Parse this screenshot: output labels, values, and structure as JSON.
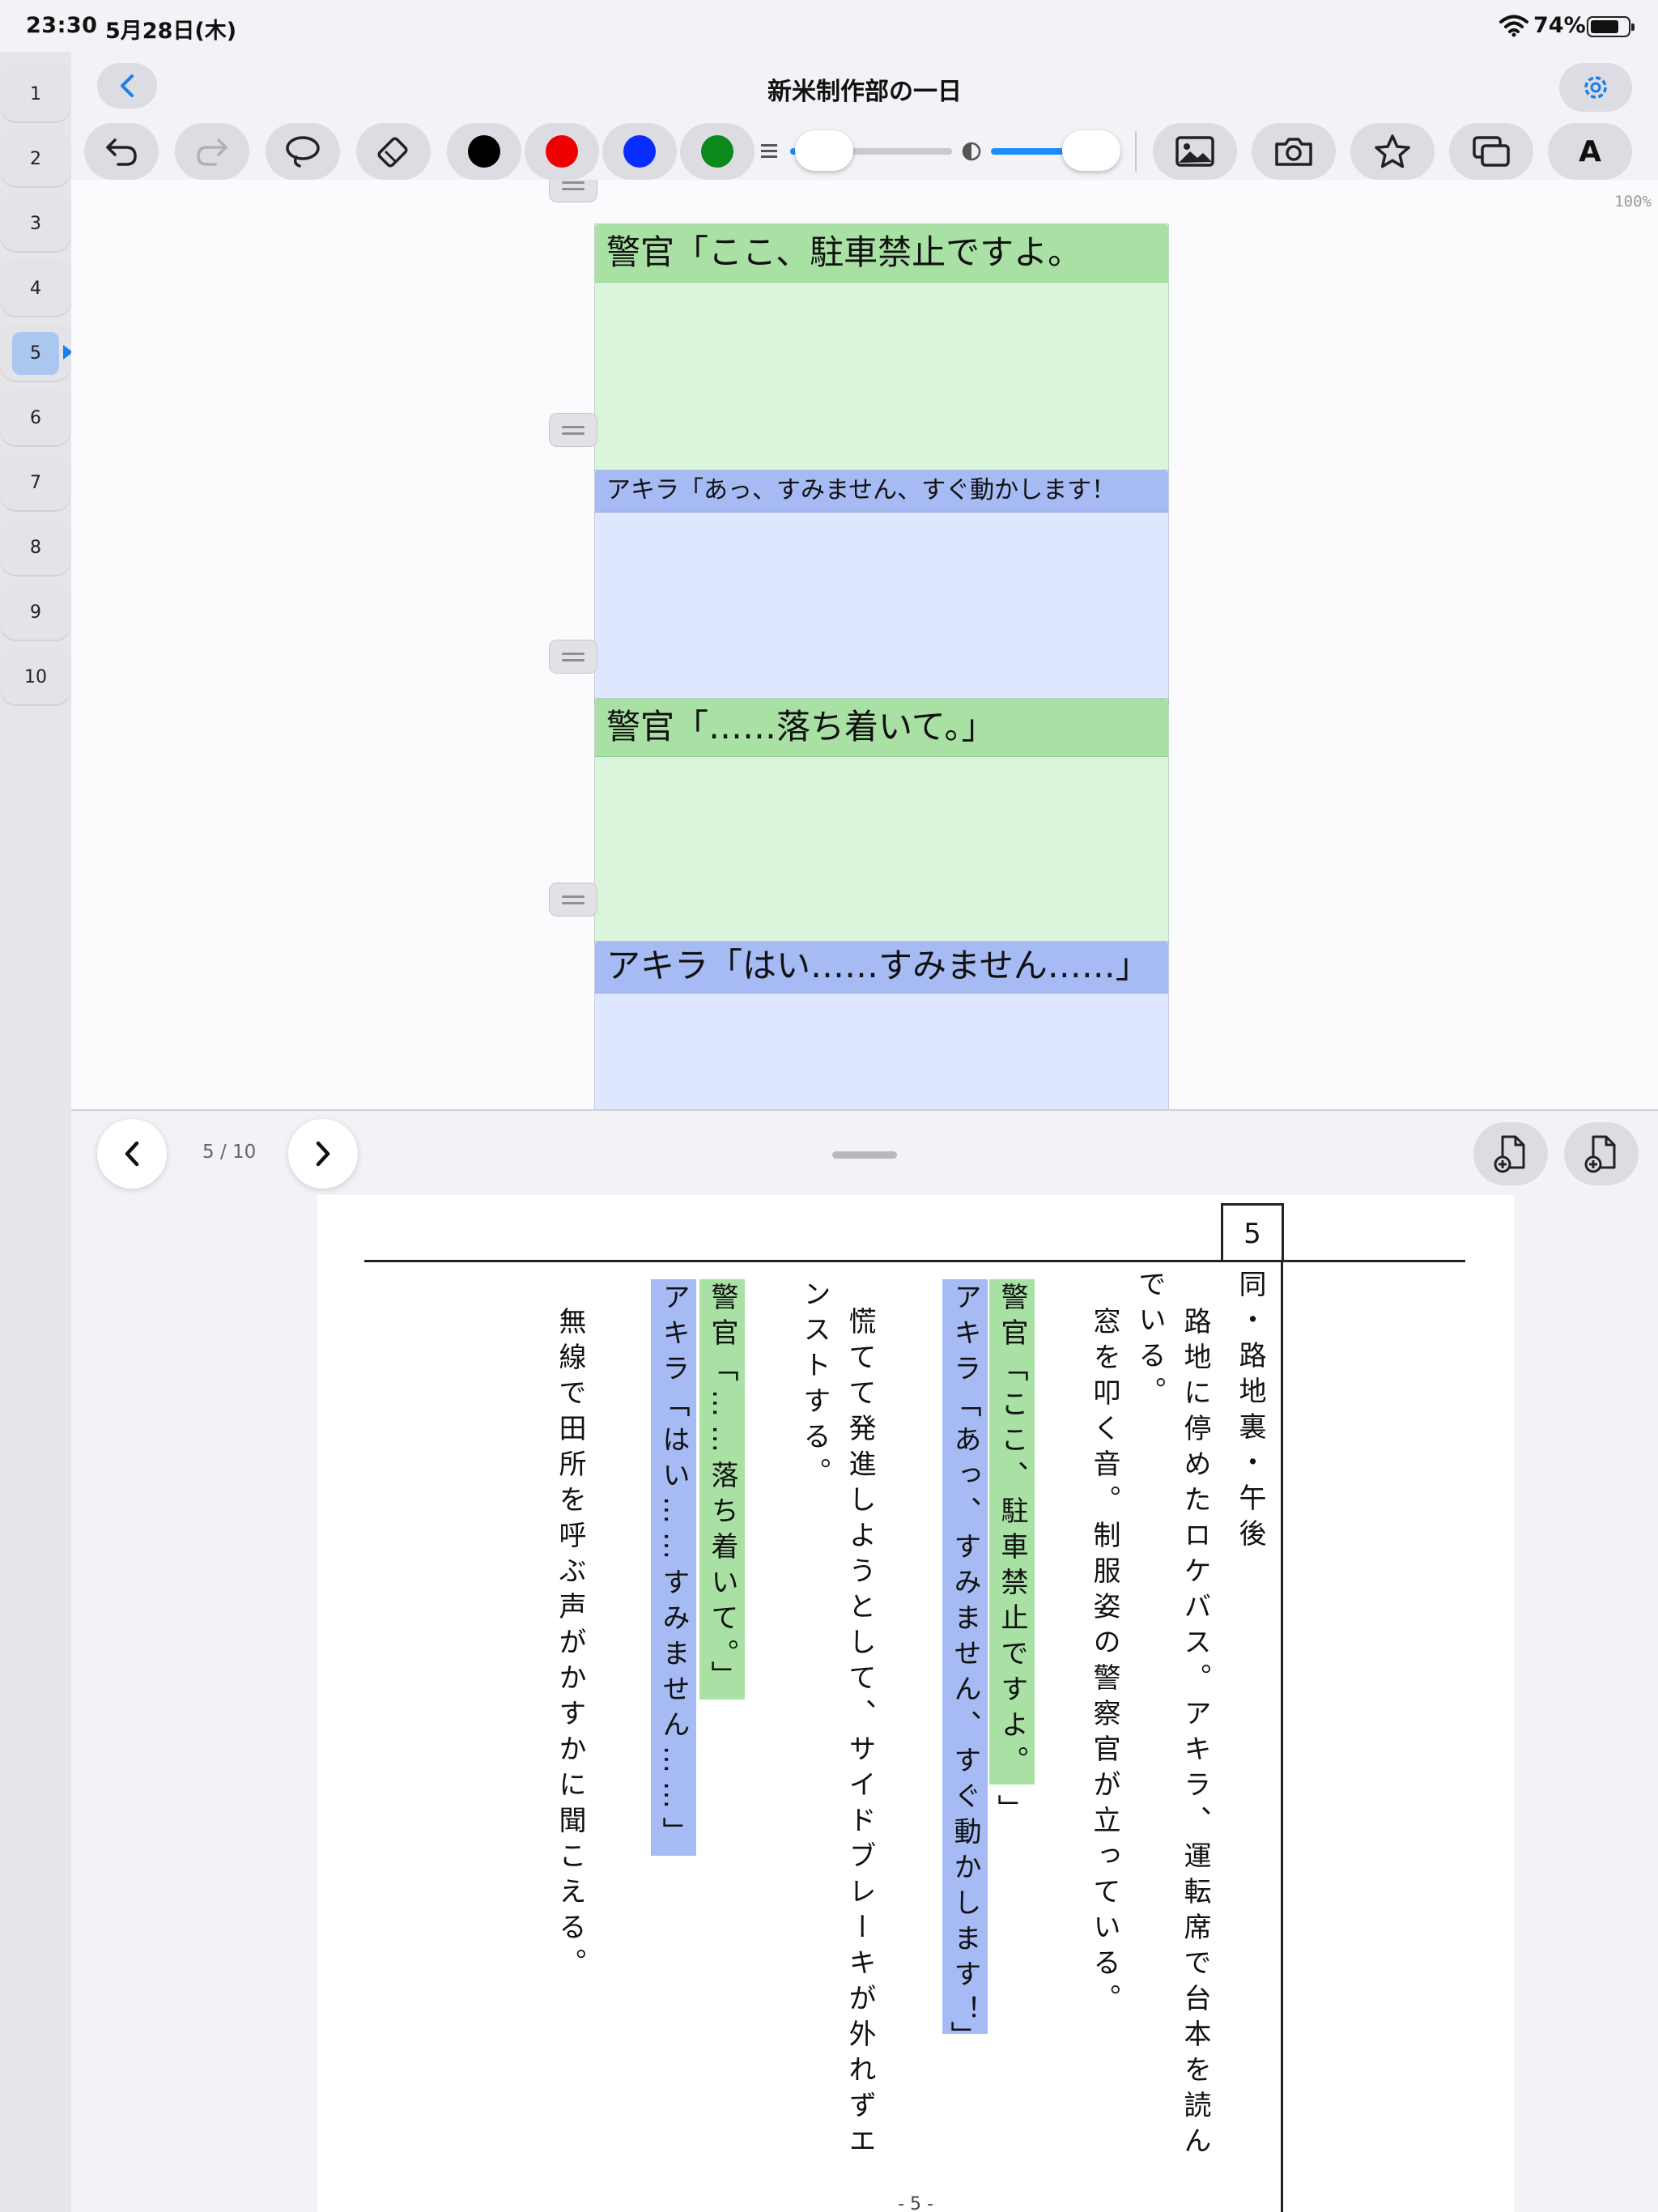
{
  "status": {
    "time": "23:30",
    "date": "5月28日(木)",
    "battery_percent": "74%"
  },
  "sidebar": {
    "pages": [
      "1",
      "2",
      "3",
      "4",
      "5",
      "6",
      "7",
      "8",
      "9",
      "10"
    ],
    "active_page": "5"
  },
  "header": {
    "title": "新米制作部の一日"
  },
  "toolbar": {
    "colors": [
      "#000000",
      "#ee0000",
      "#0a2cff",
      "#0a8a1a"
    ],
    "stroke_width": 0.1,
    "opacity": 1.0,
    "text_tool_label": "A",
    "icons": [
      "undo-icon",
      "redo-icon",
      "lasso-icon",
      "eraser-icon",
      "image-icon",
      "camera-icon",
      "star-icon",
      "duplicate-icon",
      "text-icon"
    ]
  },
  "canvas": {
    "zoom": "100%",
    "blocks": [
      {
        "speaker": "警官",
        "text": "警官「ここ、駐車禁止ですよ。",
        "color": "green"
      },
      {
        "speaker": "アキラ",
        "text": "アキラ「あっ、すみません、すぐ動かします！",
        "color": "blue"
      },
      {
        "speaker": "警官",
        "text": "警官「……落ち着いて。」",
        "color": "green"
      },
      {
        "speaker": "アキラ",
        "text": "アキラ「はい……すみません……」",
        "color": "blue"
      }
    ]
  },
  "pager": {
    "indicator": "5 / 10"
  },
  "preview": {
    "scene_number": "5",
    "heading": "同・路地裏・午後",
    "lines": [
      {
        "text": "路地に停めたロケバス。アキラ、運転席で台本を読ん",
        "highlight": "none"
      },
      {
        "text": "でいる。",
        "highlight": "none"
      },
      {
        "text": "窓を叩く音。制服姿の警察官が立っている。",
        "highlight": "none"
      },
      {
        "text": "警官「ここ、駐車禁止ですよ。",
        "highlight": "green"
      },
      {
        "text": "」",
        "highlight": "none"
      },
      {
        "text": "アキラ「あっ、すみません、すぐ動かします！",
        "highlight": "blue"
      },
      {
        "text": "」",
        "highlight": "none"
      },
      {
        "text": "慌てて発進しようとして、サイドブレーキが外れずエ",
        "highlight": "none"
      },
      {
        "text": "ンストする。",
        "highlight": "none"
      },
      {
        "text": "警官「……落ち着いて。」",
        "highlight": "green"
      },
      {
        "text": "アキラ「はい……すみません……」",
        "highlight": "blue"
      },
      {
        "text": "無線で田所を呼ぶ声がかすかに聞こえる。",
        "highlight": "none"
      }
    ],
    "page_number": "- 5 -"
  }
}
